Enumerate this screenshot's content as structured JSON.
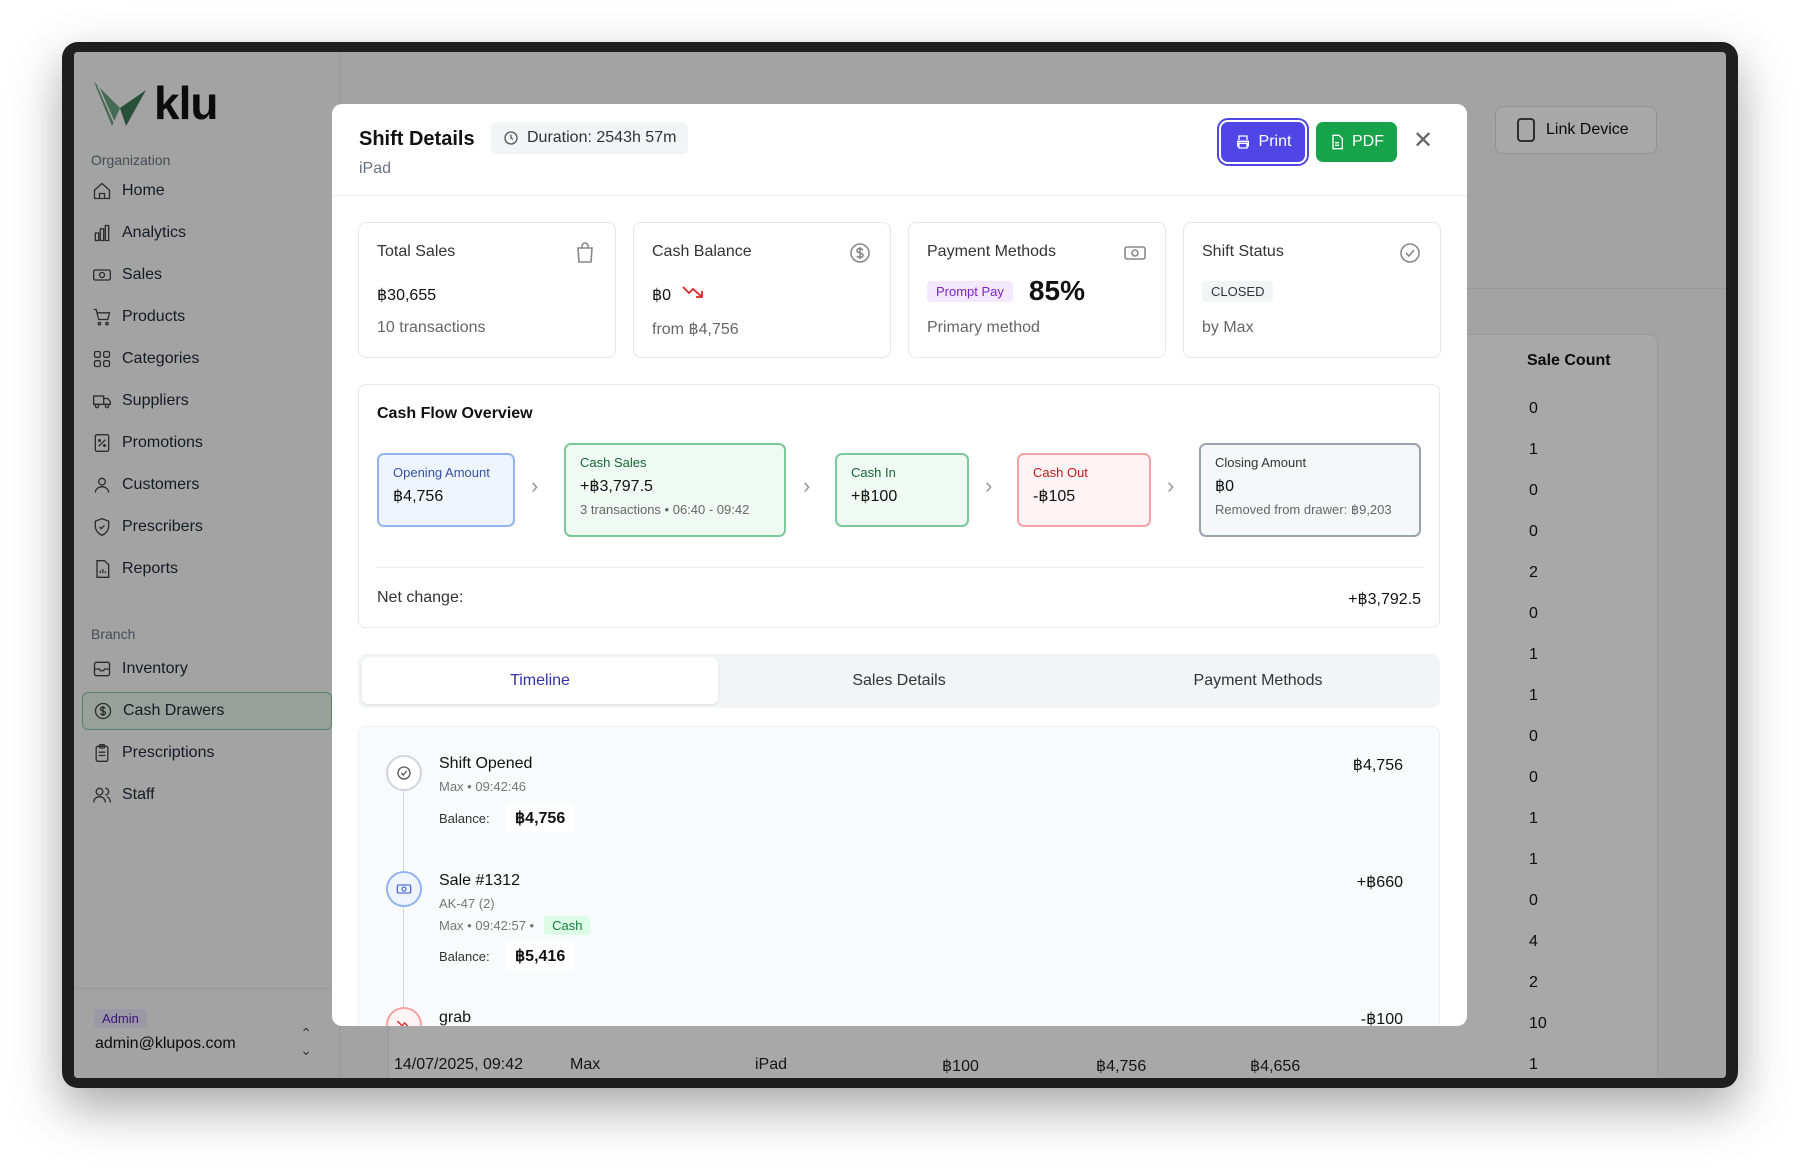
{
  "sidebar": {
    "logo": "klu",
    "org_label": "Organization",
    "org_items": [
      {
        "label": "Home",
        "icon": "home-icon"
      },
      {
        "label": "Analytics",
        "icon": "bar-chart-icon"
      },
      {
        "label": "Sales",
        "icon": "banknote-icon"
      },
      {
        "label": "Products",
        "icon": "cart-icon"
      },
      {
        "label": "Categories",
        "icon": "grid-icon"
      },
      {
        "label": "Suppliers",
        "icon": "truck-icon"
      },
      {
        "label": "Promotions",
        "icon": "percent-icon"
      },
      {
        "label": "Customers",
        "icon": "user-icon"
      },
      {
        "label": "Prescribers",
        "icon": "shield-icon"
      },
      {
        "label": "Reports",
        "icon": "file-chart-icon"
      }
    ],
    "branch_label": "Branch",
    "branch_items": [
      {
        "label": "Inventory",
        "icon": "archive-icon"
      },
      {
        "label": "Cash Drawers",
        "icon": "dollar-circle-icon",
        "active": true
      },
      {
        "label": "Prescriptions",
        "icon": "clipboard-icon"
      },
      {
        "label": "Staff",
        "icon": "users-icon"
      }
    ],
    "user": {
      "role": "Admin",
      "email": "admin@klupos.com"
    }
  },
  "background": {
    "link_device": "Link Device",
    "sale_count_header": "Sale Count",
    "sale_counts": [
      "0",
      "1",
      "0",
      "0",
      "2",
      "0",
      "1",
      "1",
      "0",
      "0",
      "1",
      "1",
      "0",
      "4",
      "2",
      "10",
      "1"
    ],
    "last_row": {
      "date": "14/07/2025, 09:42",
      "user": "Max",
      "device": "iPad",
      "a": "฿100",
      "b": "฿4,756",
      "c": "฿4,656"
    }
  },
  "modal": {
    "title": "Shift Details",
    "subtitle": "iPad",
    "duration": "Duration: 2543h 57m",
    "print": "Print",
    "pdf": "PDF",
    "cards": {
      "total_sales": {
        "title": "Total Sales",
        "value": "฿30,655",
        "sub": "10 transactions"
      },
      "cash_balance": {
        "title": "Cash Balance",
        "value": "฿0",
        "sub": "from ฿4,756"
      },
      "payment_methods": {
        "title": "Payment Methods",
        "method": "Prompt Pay",
        "pct": "85%",
        "sub": "Primary method"
      },
      "shift_status": {
        "title": "Shift Status",
        "status": "CLOSED",
        "sub": "by Max"
      }
    },
    "cash_flow": {
      "title": "Cash Flow Overview",
      "opening": {
        "label": "Opening Amount",
        "value": "฿4,756"
      },
      "cash_sales": {
        "label": "Cash Sales",
        "value": "+฿3,797.5",
        "sub": "3 transactions • 06:40 - 09:42"
      },
      "cash_in": {
        "label": "Cash In",
        "value": "+฿100"
      },
      "cash_out": {
        "label": "Cash Out",
        "value": "-฿105"
      },
      "closing": {
        "label": "Closing Amount",
        "value": "฿0",
        "sub": "Removed from drawer: ฿9,203"
      },
      "net_label": "Net change:",
      "net_value": "+฿3,792.5"
    },
    "tabs": [
      "Timeline",
      "Sales Details",
      "Payment Methods"
    ],
    "timeline": [
      {
        "title": "Shift Opened",
        "meta": "Max • 09:42:46",
        "amount": "฿4,756",
        "balance_label": "Balance:",
        "balance": "฿4,756"
      },
      {
        "title": "Sale #1312",
        "item": "AK-47 (2)",
        "meta": "Max • 09:42:57 •",
        "method": "Cash",
        "amount": "+฿660",
        "balance_label": "Balance:",
        "balance": "฿5,416"
      },
      {
        "title": "grab",
        "amount": "-฿100"
      }
    ]
  },
  "colors": {
    "accent": "#4f46e5",
    "pdf": "#16a34a",
    "active_nav": "#e7f3ec"
  }
}
